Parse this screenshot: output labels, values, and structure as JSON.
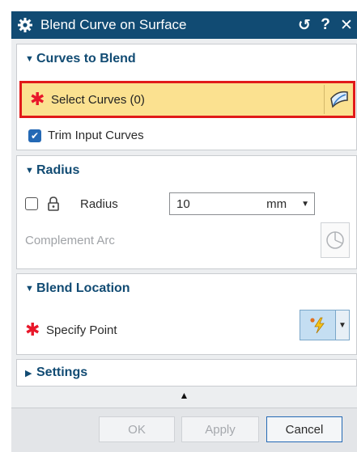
{
  "window": {
    "title": "Blend Curve on Surface",
    "reset_symbol": "↺",
    "help_symbol": "?",
    "close_symbol": "✕"
  },
  "groups": {
    "curves": {
      "header": "Curves to Blend",
      "select_label": "Select Curves (0)",
      "trim_label": "Trim Input Curves",
      "trim_checked": true
    },
    "radius": {
      "header": "Radius",
      "radius_label": "Radius",
      "radius_value": "10",
      "unit": "mm",
      "complement_label": "Complement Arc"
    },
    "location": {
      "header": "Blend Location",
      "point_label": "Specify Point"
    },
    "settings": {
      "header": "Settings"
    }
  },
  "footer": {
    "ok": "OK",
    "apply": "Apply",
    "cancel": "Cancel"
  },
  "colors": {
    "title_bar": "#114b73",
    "selection_highlight": "#fbe190",
    "selection_border": "#e11a1a",
    "required_asterisk": "#e8172a",
    "checkbox_checked": "#2469b5"
  },
  "icons": [
    "gear-icon",
    "reset-icon",
    "help-icon",
    "close-icon",
    "curve-select-icon",
    "lock-icon",
    "arc-icon",
    "point-snap-icon"
  ]
}
